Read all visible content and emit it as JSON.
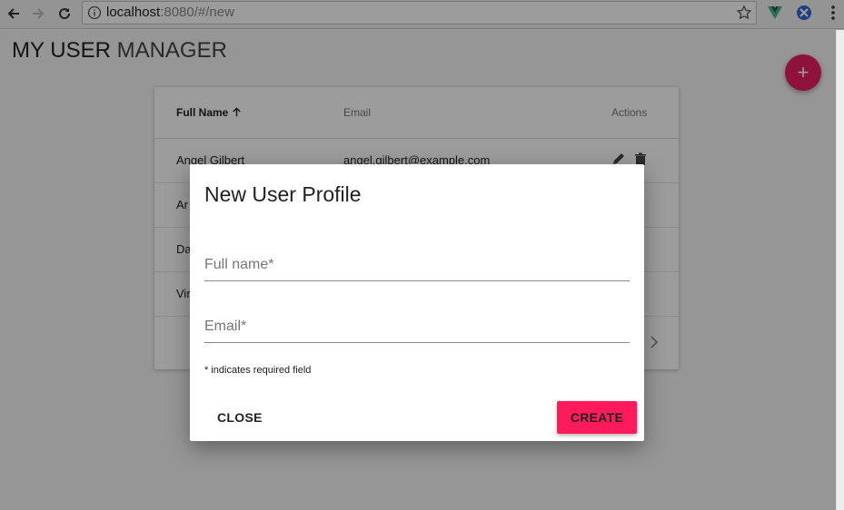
{
  "browser": {
    "url_host": "localhost",
    "url_rest": ":8080/#/new"
  },
  "app": {
    "title_bold": "MY USER",
    "title_thin": " MANAGER",
    "fab_label": "+"
  },
  "table": {
    "headers": {
      "name": "Full Name",
      "email": "Email",
      "actions": "Actions"
    },
    "rows": [
      {
        "name": "Angel Gilbert",
        "email": "angel.gilbert@example.com"
      },
      {
        "name": "Ar",
        "email": ""
      },
      {
        "name": "Da",
        "email": ""
      },
      {
        "name": "Vir",
        "email": ""
      }
    ]
  },
  "dialog": {
    "title": "New User Profile",
    "fullname_placeholder": "Full name*",
    "email_placeholder": "Email*",
    "hint": "* indicates required field",
    "close_label": "CLOSE",
    "create_label": "CREATE"
  },
  "colors": {
    "accent": "#e91e63",
    "create_button": "#ff1a5b"
  }
}
